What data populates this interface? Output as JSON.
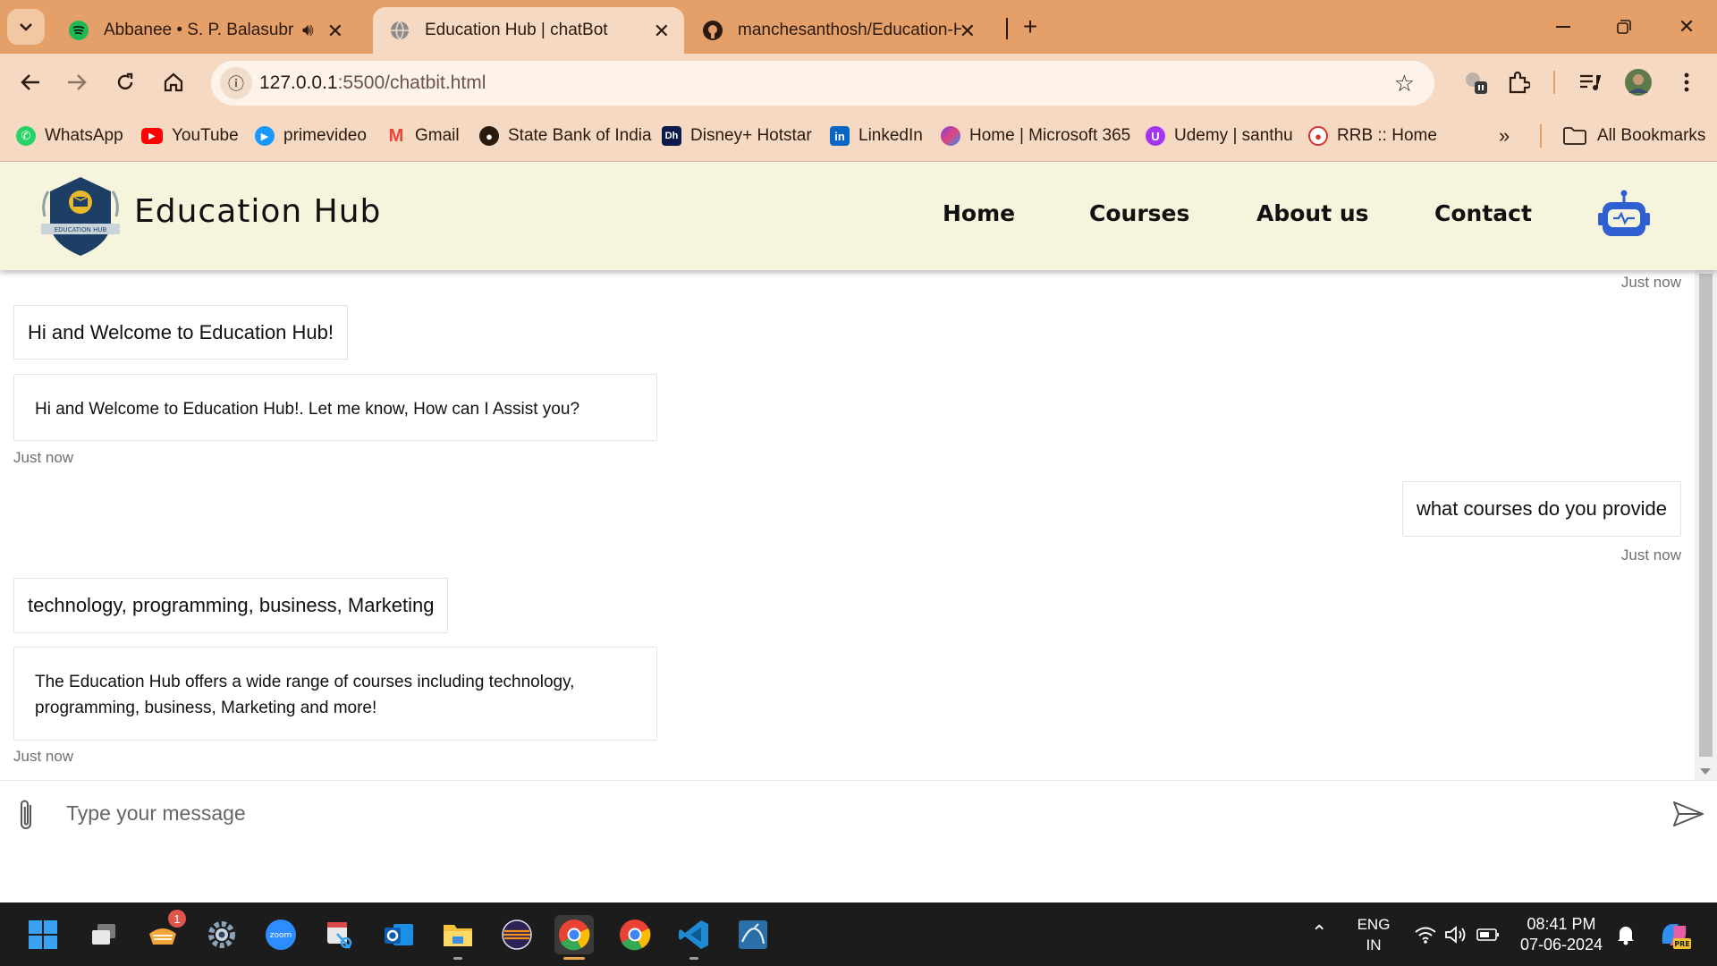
{
  "browser": {
    "tabs": [
      {
        "title": "Abbanee • S. P. Balasubrahmanyam",
        "active": false
      },
      {
        "title": "Education Hub | chatBot",
        "active": true
      },
      {
        "title": "manchesanthosh/Education-Hub",
        "active": false
      }
    ],
    "address": {
      "host": "127.0.0.1",
      "path": ":5500/chatbit.html"
    },
    "bookmarks": [
      "WhatsApp",
      "YouTube",
      "primevideo",
      "Gmail",
      "State Bank of India",
      "Disney+ Hotstar",
      "LinkedIn",
      "Home | Microsoft 365",
      "Udemy | santhu",
      "RRB :: Home"
    ],
    "all_bookmarks": "All Bookmarks",
    "bookmark_icons": {
      "disney_short": "Dh",
      "linkedin_short": "in"
    }
  },
  "site": {
    "brand": "Education Hub",
    "nav": [
      "Home",
      "Courses",
      "About us",
      "Contact"
    ],
    "logo_text": "EDUCATION HUB"
  },
  "chat": {
    "messages": [
      {
        "kind": "timestamp",
        "text": "Just now"
      },
      {
        "kind": "bot-short",
        "text": "Hi and Welcome to Education Hub!"
      },
      {
        "kind": "bot-long",
        "text": "Hi and Welcome to Education Hub!. Let me know, How can I Assist you?"
      },
      {
        "kind": "timestamp",
        "text": "Just now"
      },
      {
        "kind": "user",
        "text": "what courses do you provide"
      },
      {
        "kind": "timestamp",
        "text": "Just now"
      },
      {
        "kind": "bot-short",
        "text": "technology, programming, business, Marketing"
      },
      {
        "kind": "bot-long",
        "text": "The Education Hub offers a wide range of courses including technology, programming, business, Marketing and more!"
      },
      {
        "kind": "timestamp",
        "text": "Just now"
      }
    ],
    "input_placeholder": "Type your message"
  },
  "taskbar": {
    "badge_count": "1",
    "zoom_label": "zoom",
    "lang": "ENG",
    "region": "IN",
    "time": "08:41 PM",
    "date": "07-06-2024",
    "copilot_badge": "PRE"
  },
  "colors": {
    "chrome_tabstrip": "#e59f68",
    "chrome_toolbar": "#f6d9c2",
    "header_bg": "#f6f4dc",
    "logo_navy": "#1d3f66",
    "bot_blue": "#2f5fd1"
  }
}
